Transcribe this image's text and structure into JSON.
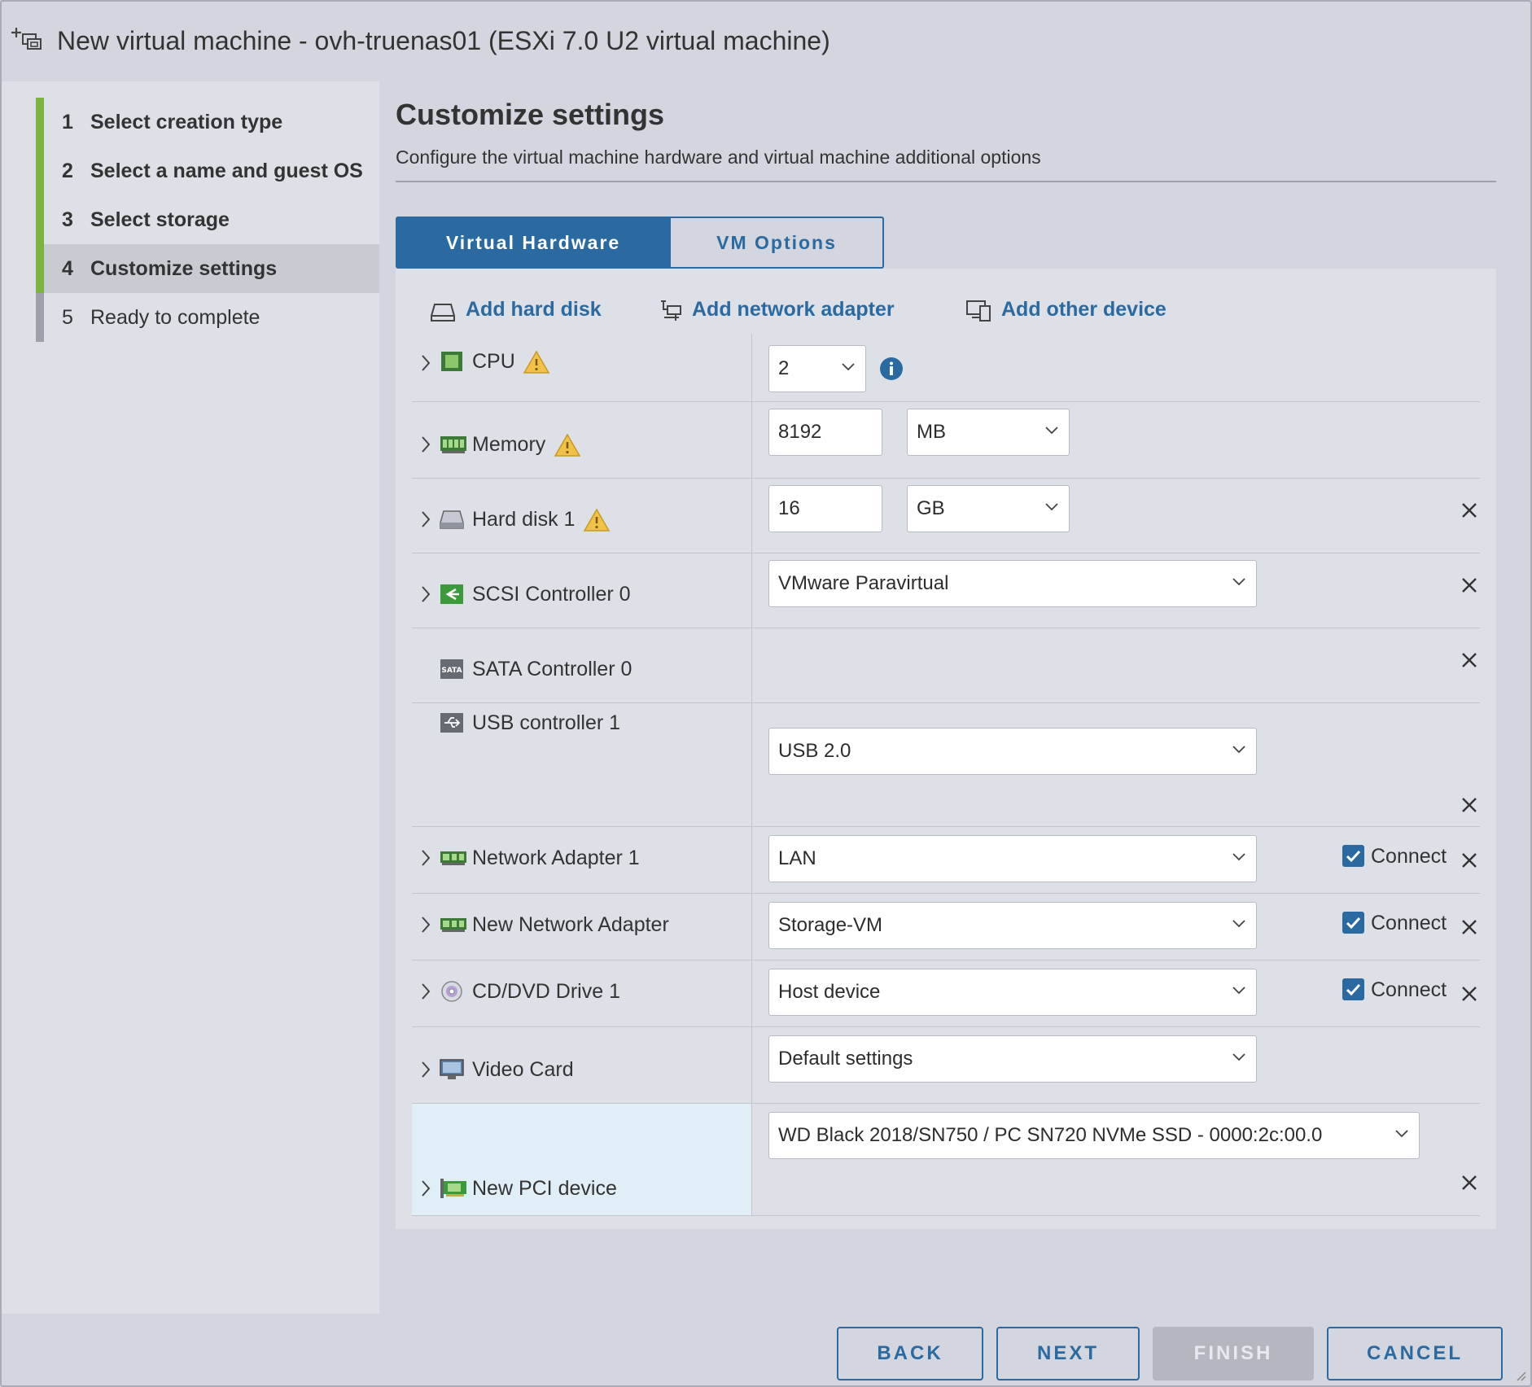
{
  "window": {
    "title": "New virtual machine - ovh-truenas01 (ESXi 7.0 U2 virtual machine)"
  },
  "steps": [
    {
      "num": "1",
      "label": "Select creation type"
    },
    {
      "num": "2",
      "label": "Select a name and guest OS"
    },
    {
      "num": "3",
      "label": "Select storage"
    },
    {
      "num": "4",
      "label": "Customize settings"
    },
    {
      "num": "5",
      "label": "Ready to complete"
    }
  ],
  "page": {
    "title": "Customize settings",
    "subtitle": "Configure the virtual machine hardware and virtual machine additional options"
  },
  "tabs": {
    "virtual_hardware": "Virtual Hardware",
    "vm_options": "VM Options"
  },
  "toolbar": {
    "add_hard_disk": "Add hard disk",
    "add_network_adapter": "Add network adapter",
    "add_other_device": "Add other device"
  },
  "hardware": {
    "cpu": {
      "label": "CPU",
      "value": "2"
    },
    "memory": {
      "label": "Memory",
      "value": "8192",
      "unit": "MB"
    },
    "hard_disk": {
      "label": "Hard disk 1",
      "value": "16",
      "unit": "GB"
    },
    "scsi": {
      "label": "SCSI Controller 0",
      "value": "VMware Paravirtual"
    },
    "sata": {
      "label": "SATA Controller 0"
    },
    "usb": {
      "label": "USB controller 1",
      "value": "USB 2.0"
    },
    "net1": {
      "label": "Network Adapter 1",
      "value": "LAN",
      "connect": "Connect"
    },
    "net2": {
      "label": "New Network Adapter",
      "value": "Storage-VM",
      "connect": "Connect"
    },
    "cdrom": {
      "label": "CD/DVD Drive 1",
      "value": "Host device",
      "connect": "Connect"
    },
    "video": {
      "label": "Video Card",
      "value": "Default settings"
    },
    "pci": {
      "label": "New PCI device",
      "value": "WD Black 2018/SN750 / PC SN720 NVMe SSD - 0000:2c:00.0"
    }
  },
  "buttons": {
    "back": "BACK",
    "next": "NEXT",
    "finish": "FINISH",
    "cancel": "CANCEL"
  },
  "colors": {
    "accent": "#2a6aa0",
    "step_done": "#7fb33f",
    "warning": "#f0c24a"
  }
}
